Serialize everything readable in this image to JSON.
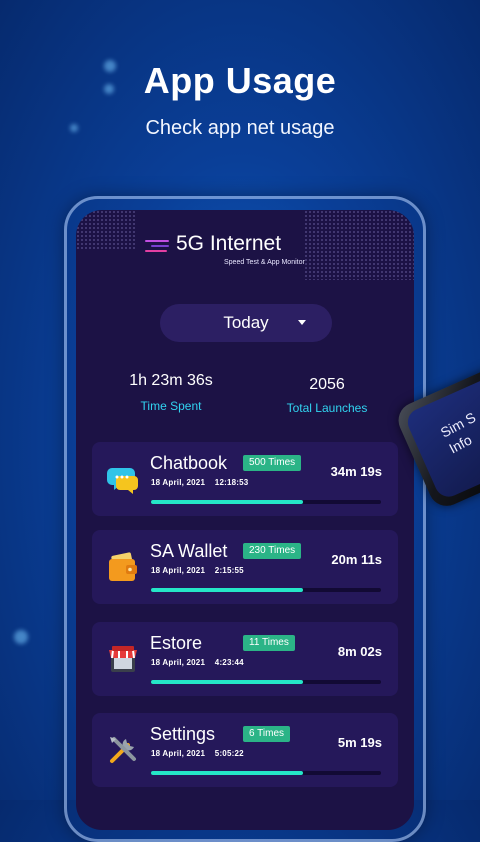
{
  "promo": {
    "headline": "App Usage",
    "subline": "Check app net usage"
  },
  "app_header": {
    "title": "5G Internet",
    "subtitle": "Speed Test & App Monitor"
  },
  "filter": {
    "selected": "Today"
  },
  "summary": {
    "time_spent_value": "1h 23m 36s",
    "time_spent_label": "Time Spent",
    "launches_value": "2056",
    "launches_label": "Total Launches"
  },
  "apps": [
    {
      "name": "Chatbook",
      "badge": "500 Times",
      "date": "18 April, 2021",
      "time": "12:18:53",
      "duration": "34m 19s",
      "progress": 0.66,
      "icon": "chat-bubbles-icon"
    },
    {
      "name": "SA Wallet",
      "badge": "230 Times",
      "date": "18 April, 2021",
      "time": "2:15:55",
      "duration": "20m 11s",
      "progress": 0.66,
      "icon": "wallet-icon"
    },
    {
      "name": "Estore",
      "badge": "11 Times",
      "date": "18 April, 2021",
      "time": "4:23:44",
      "duration": "8m 02s",
      "progress": 0.66,
      "icon": "store-icon"
    },
    {
      "name": "Settings",
      "badge": "6 Times",
      "date": "18 April, 2021",
      "time": "5:05:22",
      "duration": "5m 19s",
      "progress": 0.66,
      "icon": "tools-icon"
    }
  ],
  "side_phone_text": "Sim S\nInfo",
  "colors": {
    "accent": "#31d3f0",
    "badge": "#2bb487",
    "progress": "#25e6c8",
    "card": "#25185a",
    "screen": "#1c1245"
  }
}
